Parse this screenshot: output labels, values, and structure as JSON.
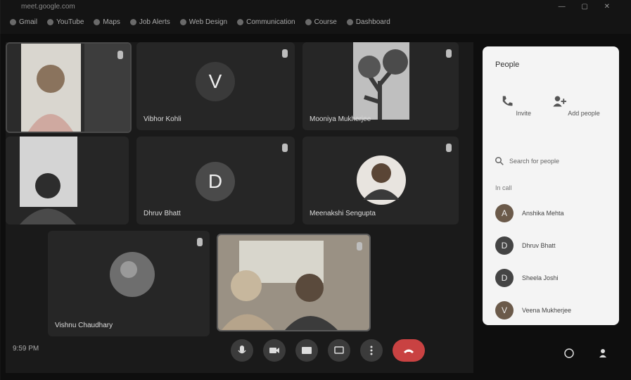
{
  "browser": {
    "title_url": "meet.google.com",
    "bookmarks": [
      "Gmail",
      "YouTube",
      "Maps",
      "Job Alerts",
      "Web Design",
      "Communication",
      "Course",
      "Dashboard"
    ]
  },
  "tiles": [
    {
      "name": "",
      "type": "photo"
    },
    {
      "name": "Vibhor Kohli",
      "type": "letter",
      "letter": "V"
    },
    {
      "name": "Mooniya Mukherjee",
      "type": "photo"
    },
    {
      "name": "",
      "type": "photo"
    },
    {
      "name": "Dhruv Bhatt",
      "type": "letter",
      "letter": "D"
    },
    {
      "name": "Meenakshi Sengupta",
      "type": "photo"
    },
    {
      "name": "Vishnu Chaudhary",
      "type": "avatar"
    },
    {
      "name": "",
      "type": "photo"
    }
  ],
  "meeting_time": "9:59 PM",
  "panel": {
    "title": "People",
    "add_people": "Add people",
    "invite": "Invite",
    "search_placeholder": "Search for people",
    "section": "In call",
    "people": [
      {
        "name": "Anshika Mehta",
        "initial": "A",
        "color": "#6b5a4a"
      },
      {
        "name": "Dhruv Bhatt",
        "initial": "D",
        "color": "#444444"
      },
      {
        "name": "Sheela Joshi",
        "initial": "D",
        "color": "#444444"
      },
      {
        "name": "Veena Mukherjee",
        "initial": "V",
        "color": "#6b5a4a"
      }
    ]
  },
  "colors": {
    "end_call": "#c94242",
    "panel_bg": "#f4f4f4",
    "stage_bg": "#1a1a1a"
  }
}
